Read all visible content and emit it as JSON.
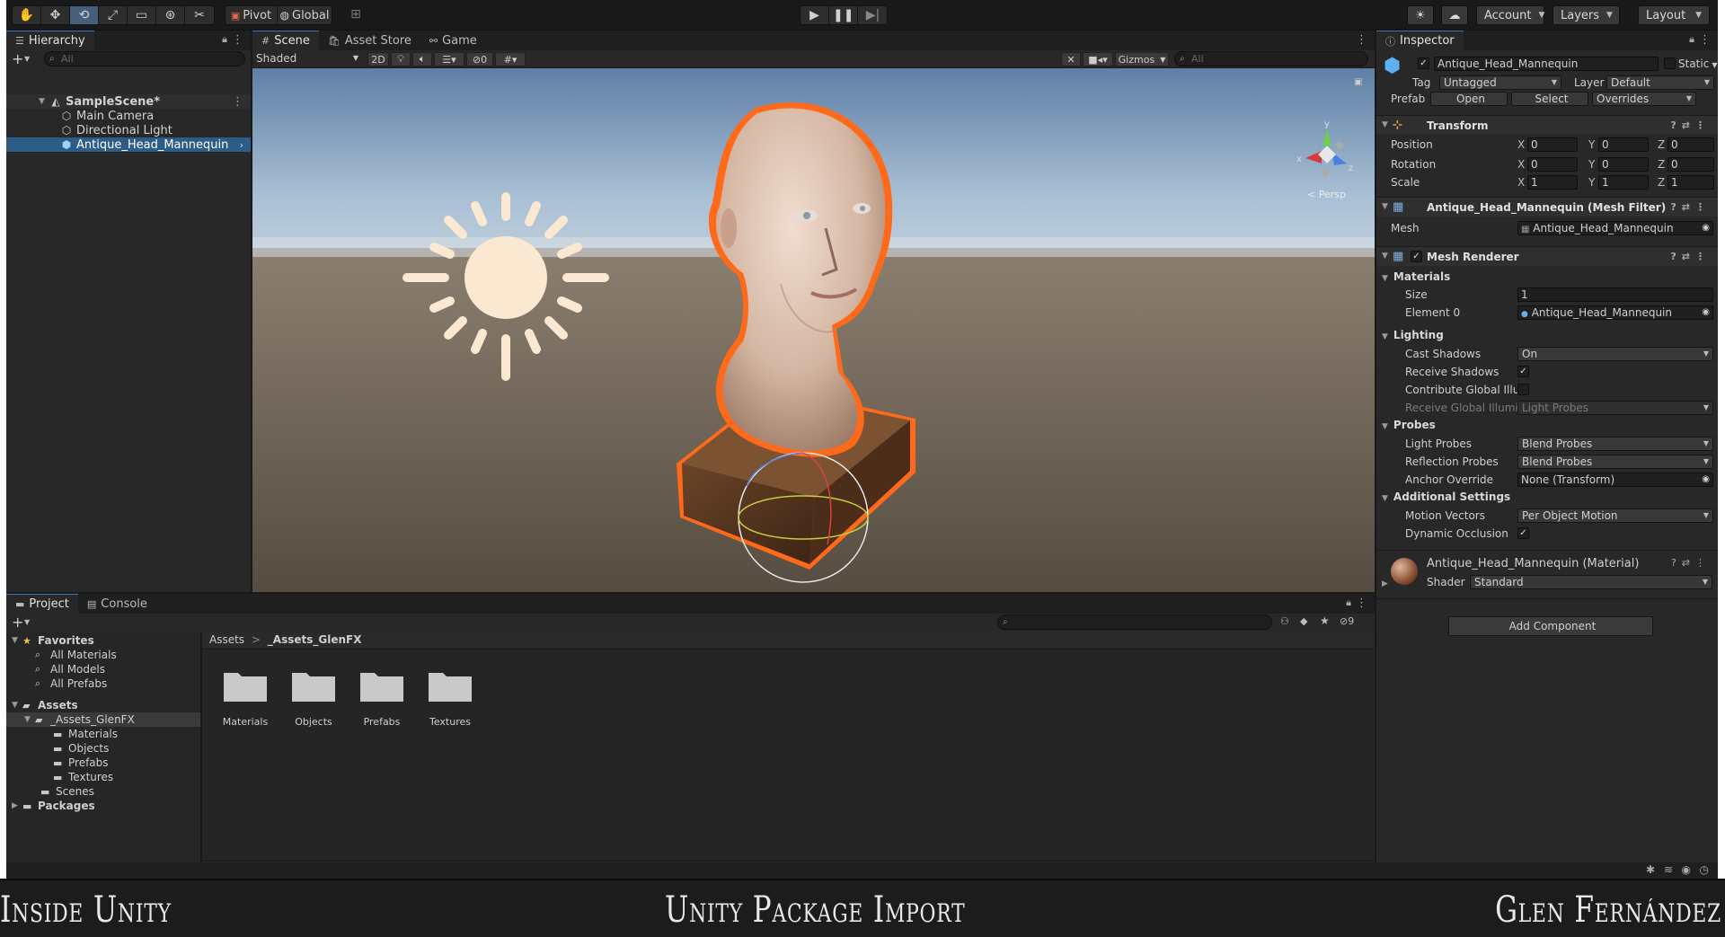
{
  "toolbar": {
    "pivot_label": "Pivot",
    "global_label": "Global",
    "account_label": "Account",
    "layers_label": "Layers",
    "layout_label": "Layout"
  },
  "hierarchy": {
    "tab": "Hierarchy",
    "search_placeholder": "All",
    "items": [
      {
        "label": "SampleScene*"
      },
      {
        "label": "Main Camera"
      },
      {
        "label": "Directional Light"
      },
      {
        "label": "Antique_Head_Mannequin"
      }
    ]
  },
  "scene": {
    "tabs": [
      "Scene",
      "Asset Store",
      "Game"
    ],
    "shading_mode": "Shaded",
    "mode_2d": "2D",
    "hidden_count": "0",
    "gizmos_label": "Gizmos",
    "search_placeholder": "All",
    "persp_label": "< Persp",
    "axis_x": "x",
    "axis_y": "y",
    "axis_z": "z"
  },
  "inspector": {
    "tab": "Inspector",
    "object_name": "Antique_Head_Mannequin",
    "static_label": "Static",
    "tag_label": "Tag",
    "tag_value": "Untagged",
    "layer_label": "Layer",
    "layer_value": "Default",
    "prefab_label": "Prefab",
    "prefab_open": "Open",
    "prefab_select": "Select",
    "prefab_overrides": "Overrides",
    "transform": {
      "title": "Transform",
      "rows": [
        {
          "label": "Position",
          "x": "0",
          "y": "0",
          "z": "0"
        },
        {
          "label": "Rotation",
          "x": "0",
          "y": "0",
          "z": "0"
        },
        {
          "label": "Scale",
          "x": "1",
          "y": "1",
          "z": "1"
        }
      ]
    },
    "mesh_filter": {
      "title": "Antique_Head_Mannequin (Mesh Filter)",
      "mesh_label": "Mesh",
      "mesh_value": "Antique_Head_Mannequin"
    },
    "mesh_renderer": {
      "title": "Mesh Renderer",
      "materials_label": "Materials",
      "size_label": "Size",
      "size_value": "1",
      "element0_label": "Element 0",
      "element0_value": "Antique_Head_Mannequin",
      "lighting_label": "Lighting",
      "cast_shadows_label": "Cast Shadows",
      "cast_shadows_value": "On",
      "receive_shadows_label": "Receive Shadows",
      "contribute_gi_label": "Contribute Global Illu",
      "receive_gi_label": "Receive Global Illumi",
      "receive_gi_value": "Light Probes",
      "probes_label": "Probes",
      "light_probes_label": "Light Probes",
      "light_probes_value": "Blend Probes",
      "reflection_probes_label": "Reflection Probes",
      "reflection_probes_value": "Blend Probes",
      "anchor_override_label": "Anchor Override",
      "anchor_override_value": "None (Transform)",
      "additional_label": "Additional Settings",
      "motion_vectors_label": "Motion Vectors",
      "motion_vectors_value": "Per Object Motion",
      "dynamic_occlusion_label": "Dynamic Occlusion"
    },
    "material": {
      "title": "Antique_Head_Mannequin (Material)",
      "shader_label": "Shader",
      "shader_value": "Standard"
    },
    "add_component": "Add Component"
  },
  "project": {
    "tabs": [
      "Project",
      "Console"
    ],
    "hidden_count": "9",
    "breadcrumb_root": "Assets",
    "breadcrumb_sep": ">",
    "breadcrumb_current": "_Assets_GlenFX",
    "tree": {
      "favorites": "Favorites",
      "fav_items": [
        "All Materials",
        "All Models",
        "All Prefabs"
      ],
      "assets": "Assets",
      "assets_glenfx": "_Assets_GlenFX",
      "sub_items": [
        "Materials",
        "Objects",
        "Prefabs",
        "Textures"
      ],
      "scenes": "Scenes",
      "packages": "Packages"
    },
    "folders": [
      "Materials",
      "Objects",
      "Prefabs",
      "Textures"
    ]
  },
  "banner": {
    "left": "Inside Unity",
    "center": "Unity Package Import",
    "right": "Glen Fernández"
  }
}
